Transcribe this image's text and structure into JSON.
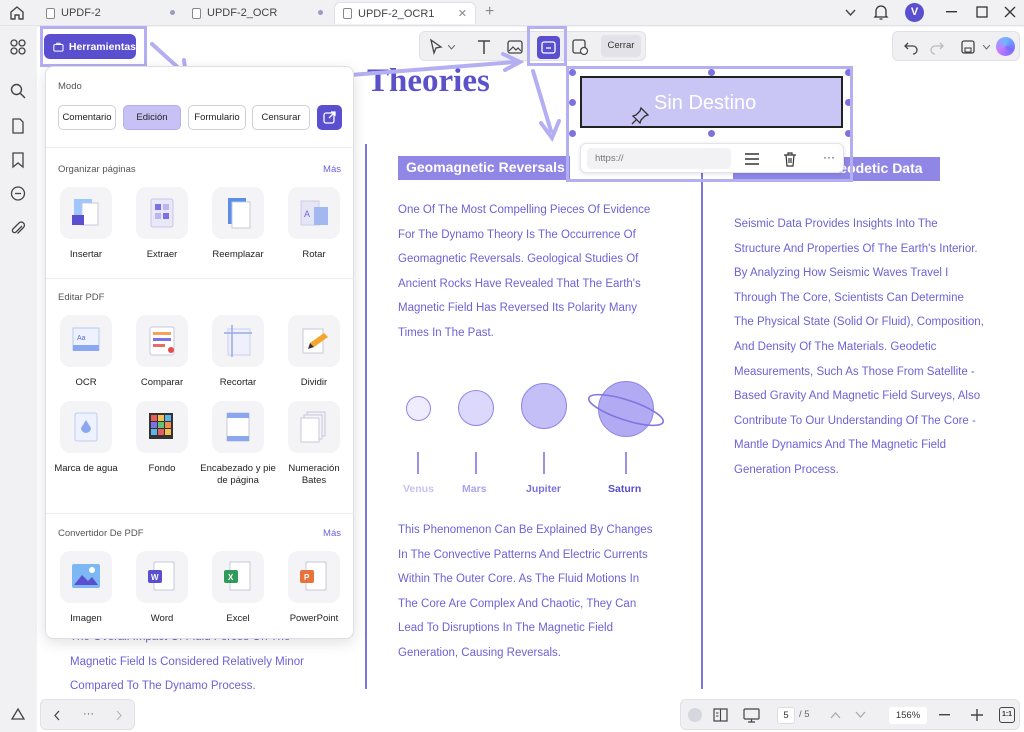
{
  "tabs": [
    {
      "label": "UPDF-2"
    },
    {
      "label": "UPDF-2_OCR"
    },
    {
      "label": "UPDF-2_OCR1",
      "close": "✕"
    }
  ],
  "window": {
    "avatar_initial": "V"
  },
  "toolbar": {
    "close_label": "Cerrar"
  },
  "tools_button": {
    "label": "Herramientas"
  },
  "panel": {
    "mode_title": "Modo",
    "modes": [
      "Comentario",
      "Edición",
      "Formulario",
      "Censurar"
    ],
    "organize_title": "Organizar páginas",
    "organize_more": "Más",
    "organize_tools": [
      "Insertar",
      "Extraer",
      "Reemplazar",
      "Rotar"
    ],
    "edit_title": "Editar PDF",
    "edit_tools": [
      "OCR",
      "Comparar",
      "Recortar",
      "Dividir"
    ],
    "edit_tools2": [
      "Marca de agua",
      "Fondo",
      "Encabezado y pie de página",
      "Numeración Bates"
    ],
    "convert_title": "Convertidor De PDF",
    "convert_more": "Más",
    "convert_tools": [
      "Imagen",
      "Word",
      "Excel",
      "PowerPoint"
    ]
  },
  "link": {
    "label": "Sin Destino",
    "url_placeholder": "https://"
  },
  "document": {
    "title": "Theories",
    "col1_lines": [
      "The Overall Impact Of Fluid Forces On The",
      "Magnetic Field Is Considered Relatively Minor",
      "Compared To The Dynamo Process."
    ],
    "col2_heading": "Geomagnetic Reversals",
    "col2_para1": [
      "One Of The Most Compelling Pieces Of Evidence",
      "For The Dynamo Theory Is The Occurrence Of",
      "Geomagnetic Reversals. Geological Studies Of",
      "Ancient Rocks Have Revealed That The Earth's",
      "Magnetic Field Has Reversed Its Polarity Many",
      "Times In The Past."
    ],
    "planets": [
      "Venus",
      "Mars",
      "Jupiter",
      "Saturn"
    ],
    "col2_para2": [
      "This Phenomenon Can Be Explained By Changes",
      "In The Convective Patterns And Electric Currents",
      "Within The Outer Core. As The Fluid Motions In",
      "The Core Are Complex And Chaotic, They Can",
      "Lead To Disruptions In The Magnetic Field",
      "Generation, Causing Reversals."
    ],
    "col3_heading": "Seismic And Geodetic Data",
    "col3_para": [
      "Seismic Data Provides Insights Into The",
      "Structure And Properties Of The Earth's Interior.",
      "By Analyzing How Seismic Waves Travel I",
      "Through The Core, Scientists Can Determine",
      "The Physical State (Solid Or Fluid), Composition,",
      "And Density Of The Materials. Geodetic",
      "Measurements, Such As Those From Satellite -",
      "Based Gravity And Magnetic Field Surveys, Also",
      "Contribute To Our Understanding Of The Core -",
      "Mantle Dynamics And The Magnetic Field",
      "Generation Process."
    ]
  },
  "bottom": {
    "nav_dots": "···",
    "page_current": "5",
    "page_total": "/ 5",
    "zoom": "156%",
    "ratio": "1:1"
  },
  "colors": {
    "accent": "#5a4fcf",
    "highlight": "#b4aef2",
    "doc_text": "#6c63d6"
  }
}
